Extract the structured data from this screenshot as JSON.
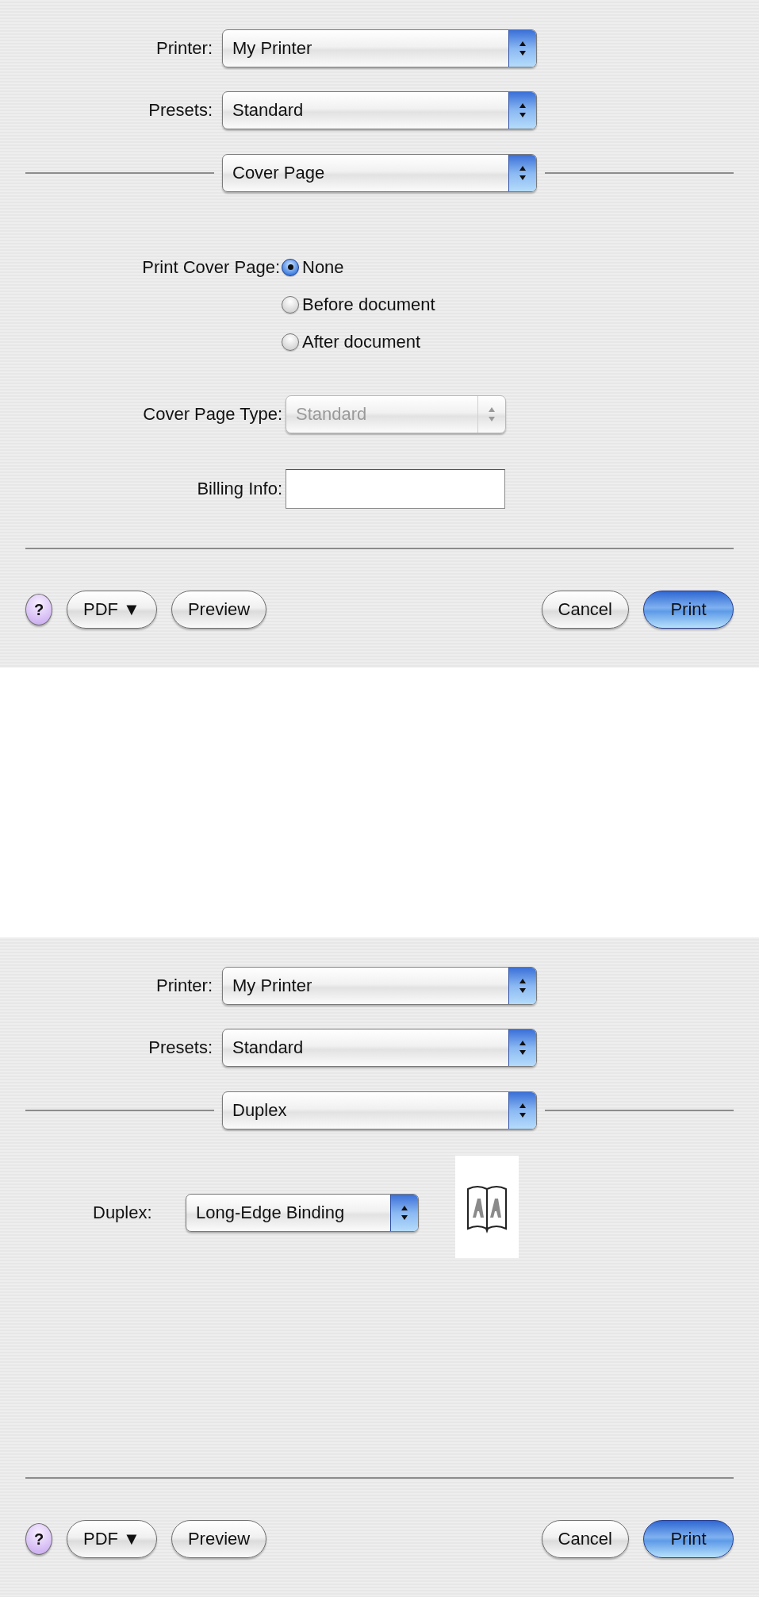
{
  "dialogs": [
    {
      "printer": {
        "label": "Printer:",
        "value": "My Printer"
      },
      "presets": {
        "label": "Presets:",
        "value": "Standard"
      },
      "pane": "Cover Page",
      "options": [
        {
          "kind": "radio_group",
          "label": "Print Cover Page:",
          "choices": [
            {
              "label": "None",
              "selected": true
            },
            {
              "label": "Before document",
              "selected": false
            },
            {
              "label": "After document",
              "selected": false
            }
          ]
        },
        {
          "kind": "popup",
          "label": "Cover Page Type:",
          "value": "Standard",
          "disabled": true
        },
        {
          "kind": "text_field",
          "label": "Billing Info:"
        }
      ],
      "left_buttons": [
        {
          "kind": "help",
          "label": "?"
        },
        {
          "kind": "plain",
          "label": "PDF ▼"
        },
        {
          "kind": "plain",
          "label": "Preview"
        }
      ],
      "right_buttons": [
        {
          "kind": "plain",
          "label": "Cancel"
        },
        {
          "kind": "default",
          "label": "Print"
        }
      ]
    },
    {
      "printer": {
        "label": "Printer:",
        "value": "My Printer"
      },
      "presets": {
        "label": "Presets:",
        "value": "Standard"
      },
      "pane": "Duplex",
      "options": [
        {
          "kind": "duplex",
          "label": "Duplex:",
          "value": "Long-Edge Binding"
        }
      ],
      "left_buttons": [
        {
          "kind": "help",
          "label": "?"
        },
        {
          "kind": "plain",
          "label": "PDF ▼"
        },
        {
          "kind": "plain",
          "label": "Preview"
        }
      ],
      "right_buttons": [
        {
          "kind": "plain",
          "label": "Cancel"
        },
        {
          "kind": "default",
          "label": "Print"
        }
      ]
    }
  ]
}
